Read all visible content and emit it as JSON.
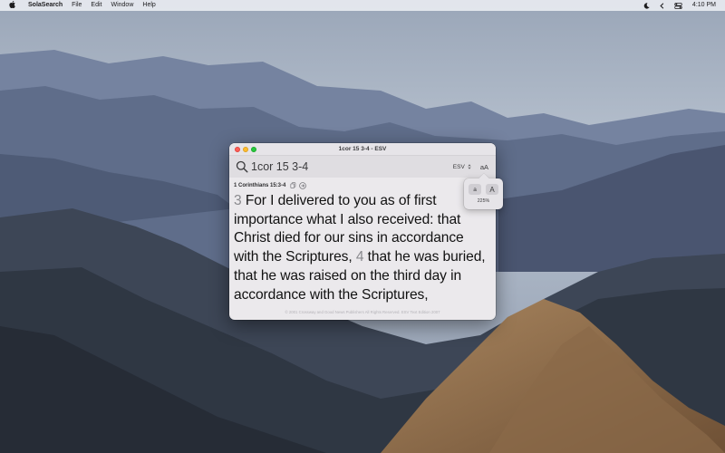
{
  "menubar": {
    "app_name": "SolaSearch",
    "menus": [
      "File",
      "Edit",
      "Window",
      "Help"
    ],
    "clock": "4:10 PM"
  },
  "window": {
    "title": "1cor 15 3-4 - ESV",
    "search": {
      "value": "1cor 15 3-4",
      "placeholder": ""
    },
    "version": "ESV",
    "font_size_toggle": "aA",
    "reference": "1 Corinthians 15:3-4",
    "verses": [
      {
        "number": "3",
        "text": "For I delivered to you as of first importance what I also received: that Christ died for our sins in accordance with the Scriptures,"
      },
      {
        "number": "4",
        "text": "that he was buried, that he was raised on the third day in accordance with the Scriptures,"
      }
    ],
    "copyright": "© 2001 Crossway and Good News Publishers All Rights Reserved. ESV Text Edition 2007"
  },
  "popover": {
    "decrease_label": "a",
    "increase_label": "A",
    "zoom": "225%"
  },
  "icons": {
    "apple": "apple-icon",
    "moon": "moon-icon",
    "back": "chevron-left-icon",
    "control_center": "control-center-icon",
    "search": "search-icon",
    "copy": "copy-icon",
    "goto": "arrow-right-circle-icon"
  },
  "colors": {
    "window_bg": "#ebe9ec",
    "verse_number": "#8a8a8e",
    "close": "#fe5f57",
    "minimize": "#febc2e",
    "zoom": "#28c840"
  }
}
